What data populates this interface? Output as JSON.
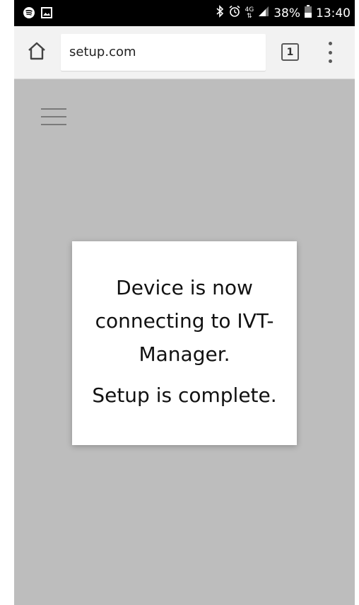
{
  "status_bar": {
    "battery": "38%",
    "time": "13:40",
    "network": "4G",
    "icons": [
      "spotify-icon",
      "image-icon",
      "bluetooth-icon",
      "alarm-icon",
      "signal-icon",
      "battery-icon"
    ]
  },
  "browser": {
    "url": "setup.com",
    "tab_count": "1"
  },
  "dialog": {
    "message": "Device is now connecting to IVT-Manager.",
    "status": "Setup is complete."
  },
  "colors": {
    "page_background": "#bdbdbd",
    "toolbar": "#f2f2f2",
    "status_bar": "#000000"
  }
}
